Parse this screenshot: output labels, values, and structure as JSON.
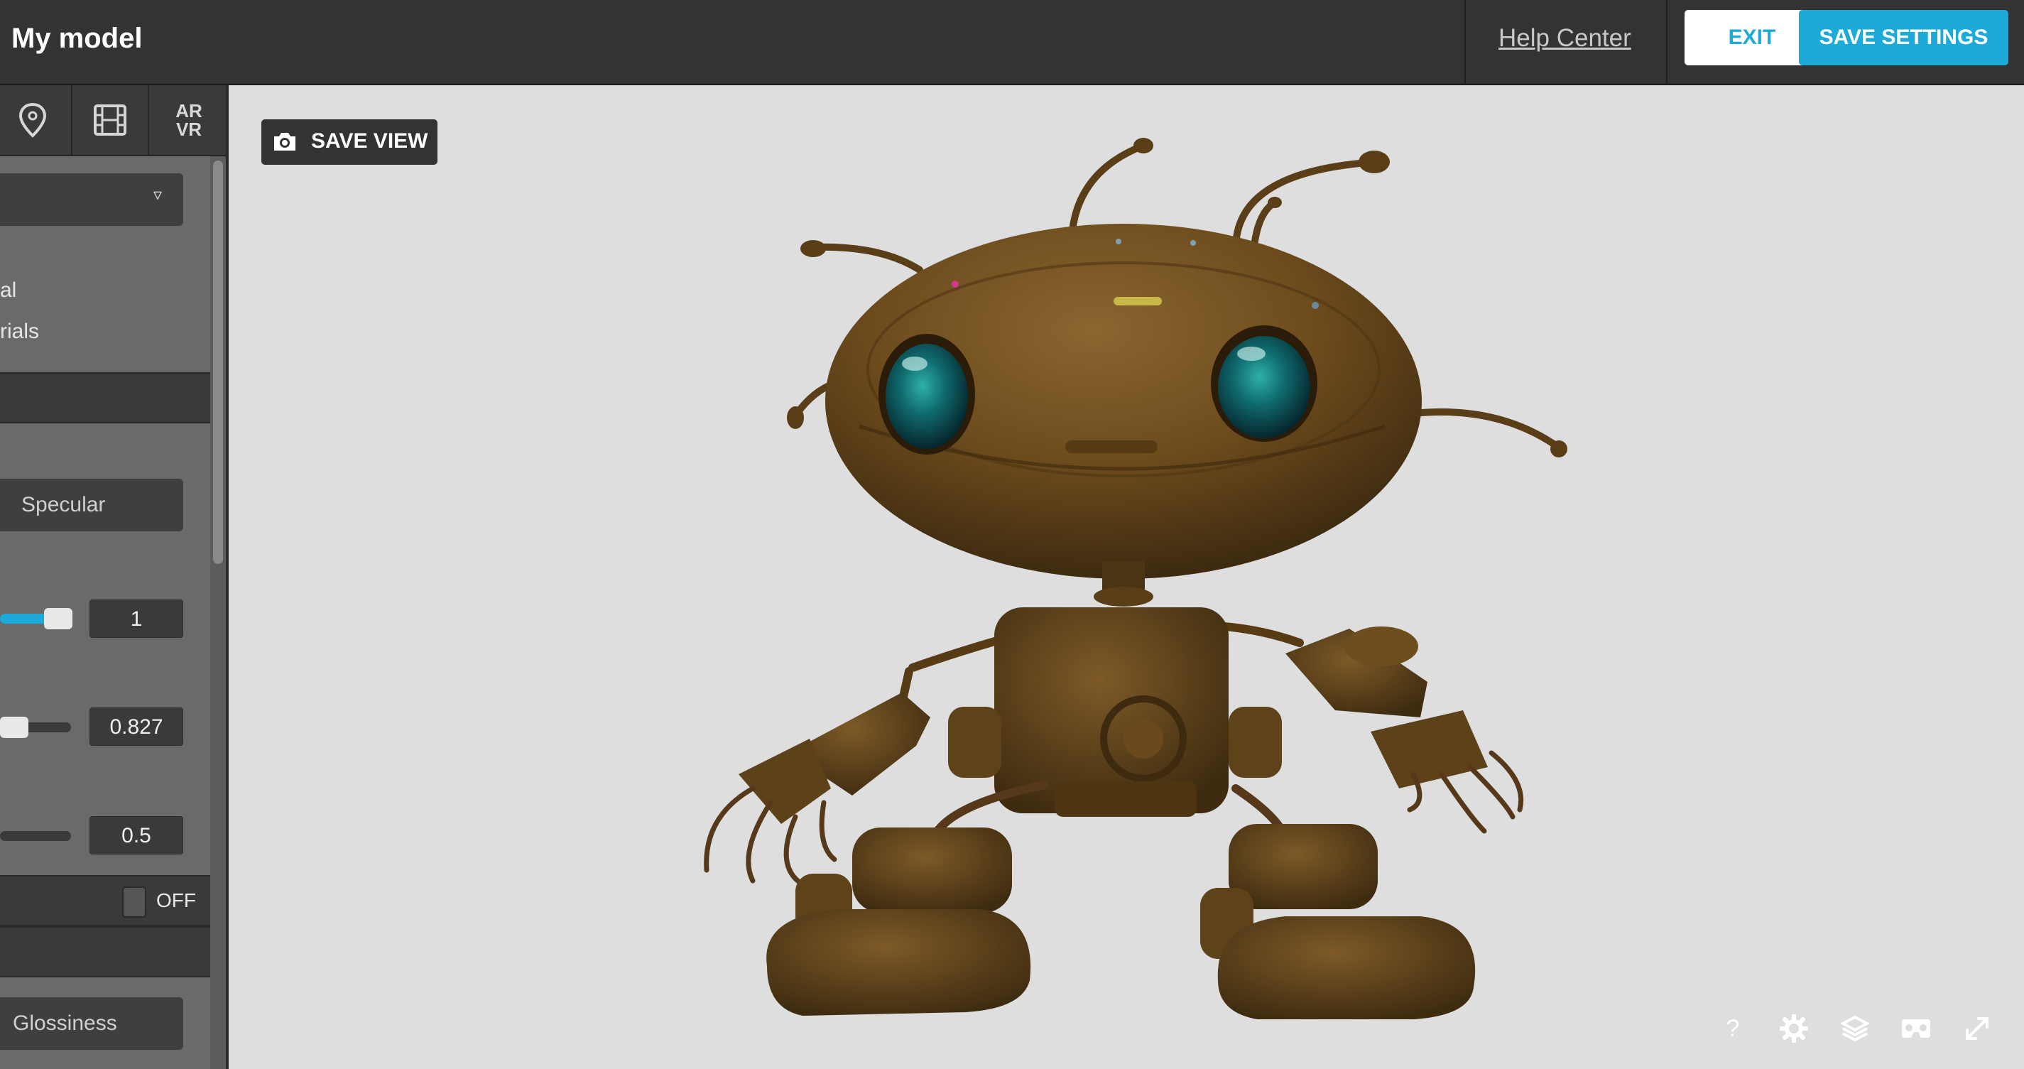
{
  "header": {
    "title": "My model",
    "help_link": "Help Center",
    "exit_label": "EXIT",
    "save_label": "SAVE SETTINGS"
  },
  "sidebar": {
    "tabs": [
      {
        "name": "annotations",
        "icon": "map-pin-icon"
      },
      {
        "name": "animations",
        "icon": "film-icon"
      },
      {
        "name": "ar-vr",
        "label": "AR\nVR"
      }
    ],
    "material_dropdown": {
      "selected": ""
    },
    "options": [
      "al",
      "rials"
    ],
    "workflow_button": "Specular",
    "slider_1": {
      "value": "1",
      "level": 1.0
    },
    "slider_2": {
      "value": "0.827",
      "level": 0.1
    },
    "slider_3": {
      "value": "0.5",
      "level": 0.0
    },
    "toggle": {
      "label": "OFF",
      "state": "off"
    },
    "glossiness_button": "Glossiness"
  },
  "viewport": {
    "save_view_label": "SAVE VIEW",
    "icons": [
      "help-icon",
      "settings-icon",
      "layers-icon",
      "vr-icon",
      "fullscreen-icon"
    ]
  },
  "colors": {
    "accent": "#1caad9",
    "topbar": "#333333",
    "sidebar": "#6a6a6a",
    "viewport_bg": "#dedede",
    "model_bronze": "#6b4a1c"
  }
}
